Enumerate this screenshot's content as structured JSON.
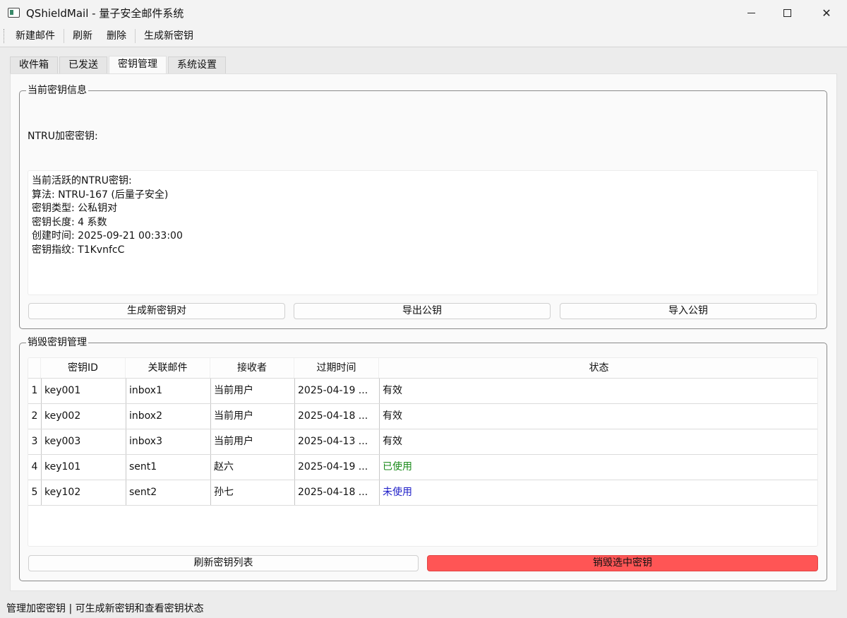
{
  "window": {
    "title": "QShieldMail - 量子安全邮件系统"
  },
  "toolbar": {
    "items": [
      "新建邮件",
      "刷新",
      "删除",
      "生成新密钥"
    ]
  },
  "tabs": [
    "收件箱",
    "已发送",
    "密钥管理",
    "系统设置"
  ],
  "active_tab": "密钥管理",
  "current_key": {
    "group_title": "当前密钥信息",
    "label": "NTRU加密密钥:",
    "info_lines": [
      "当前活跃的NTRU密钥:",
      "算法: NTRU-167 (后量子安全)",
      "密钥类型: 公私钥对",
      "密钥长度: 4 系数",
      "创建时间: 2025-09-21 00:33:00",
      "密钥指纹: T1KvnfcC"
    ],
    "buttons": {
      "generate": "生成新密钥对",
      "export": "导出公钥",
      "import": "导入公钥"
    }
  },
  "destroy_keys": {
    "group_title": "销毁密钥管理",
    "columns": [
      "密钥ID",
      "关联邮件",
      "接收者",
      "过期时间",
      "状态"
    ],
    "rows": [
      {
        "num": "1",
        "id": "key001",
        "mail": "inbox1",
        "recipient": "当前用户",
        "expire": "2025-04-19 ...",
        "status": "有效",
        "status_color": "#111111"
      },
      {
        "num": "2",
        "id": "key002",
        "mail": "inbox2",
        "recipient": "当前用户",
        "expire": "2025-04-18 ...",
        "status": "有效",
        "status_color": "#111111"
      },
      {
        "num": "3",
        "id": "key003",
        "mail": "inbox3",
        "recipient": "当前用户",
        "expire": "2025-04-13 ...",
        "status": "有效",
        "status_color": "#111111"
      },
      {
        "num": "4",
        "id": "key101",
        "mail": "sent1",
        "recipient": "赵六",
        "expire": "2025-04-19 ...",
        "status": "已使用",
        "status_color": "#1a8a1a"
      },
      {
        "num": "5",
        "id": "key102",
        "mail": "sent2",
        "recipient": "孙七",
        "expire": "2025-04-18 ...",
        "status": "未使用",
        "status_color": "#1f1fc8"
      }
    ],
    "buttons": {
      "refresh": "刷新密钥列表",
      "destroy": "销毁选中密钥"
    },
    "destroy_color": "#ff5555"
  },
  "status_bar": "管理加密密钥 | 可生成新密钥和查看密钥状态"
}
